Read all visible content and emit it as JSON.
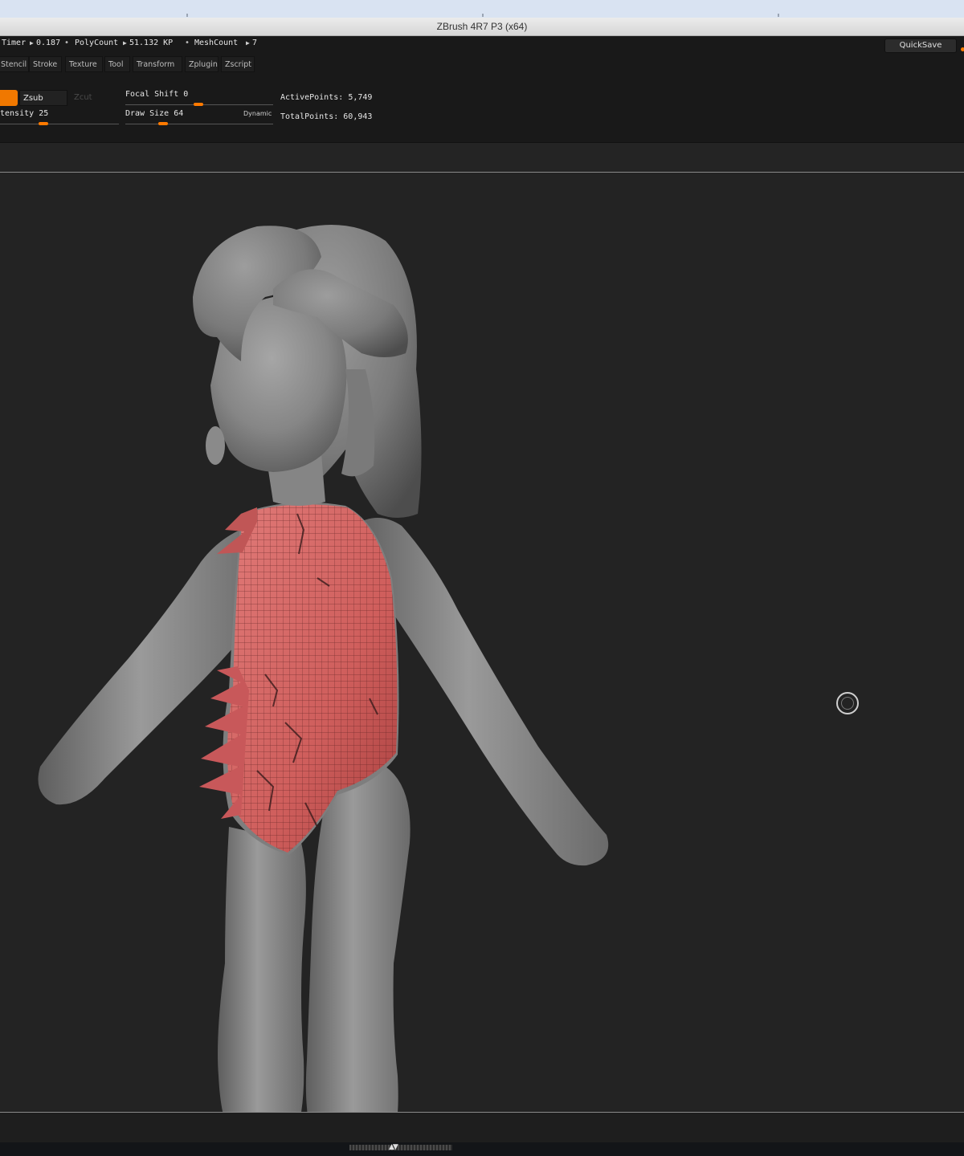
{
  "window": {
    "title": "ZBrush 4R7 P3 (x64)"
  },
  "status": {
    "timer_label": "Timer",
    "timer_value": "0.187",
    "polycount_label": "PolyCount",
    "polycount_value": "51.132 KP",
    "meshcount_label": "MeshCount",
    "meshcount_value": "7"
  },
  "quicksave_label": "QuickSave",
  "menus": [
    "Stencil",
    "Stroke",
    "Texture",
    "Tool",
    "Transform",
    "Zplugin",
    "Zscript"
  ],
  "brush": {
    "zsub_label": "Zsub",
    "zcut_label": "Zcut",
    "intensity_label": "tensity",
    "intensity_value": "25",
    "focal_shift_label": "Focal Shift",
    "focal_shift_value": "0",
    "draw_size_label": "Draw Size",
    "draw_size_value": "64",
    "dynamic_label": "Dynamic"
  },
  "points": {
    "active_label": "ActivePoints:",
    "active_value": "5,749",
    "total_label": "TotalPoints:",
    "total_value": "60,943"
  },
  "colors": {
    "accent": "#ff7a00",
    "mesh_gray": "#8c8c8c",
    "mask_red": "#d76462",
    "background": "#232323"
  },
  "icons": {
    "cursor": "brush-cursor-ring-icon",
    "tray": "tray-toggle-arrows-icon"
  }
}
